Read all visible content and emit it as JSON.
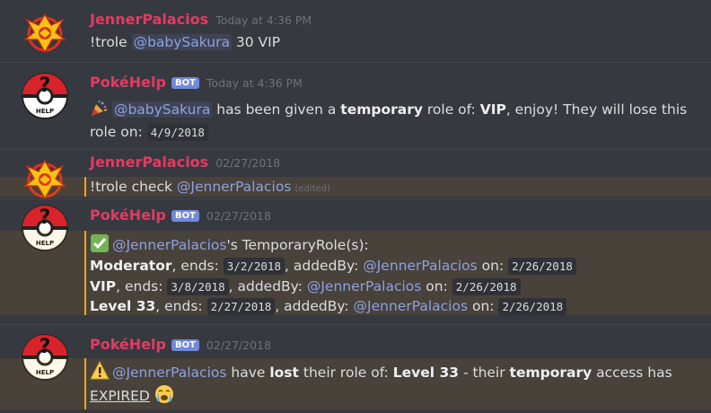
{
  "messages": [
    {
      "author": "JennerPalacios",
      "timestamp": "Today at 4:36 PM",
      "text_prefix": "!trole ",
      "mention": "@babySakura",
      "text_suffix": " 30 VIP"
    },
    {
      "author": "PokéHelp",
      "bot_tag": "BOT",
      "timestamp": "Today at 4:36 PM",
      "mention": "@babySakura",
      "t1": " has been given a ",
      "bold1": "temporary",
      "t2": " role of: ",
      "bold2": "VIP",
      "t3": ", enjoy! They will lose this",
      "t4": "role on: ",
      "date": "4/9/2018"
    },
    {
      "author": "JennerPalacios",
      "timestamp": "02/27/2018",
      "text_prefix": "!trole check ",
      "mention": "@JennerPalacios",
      "edited": "(edited)"
    },
    {
      "author": "PokéHelp",
      "bot_tag": "BOT",
      "timestamp": "02/27/2018",
      "mention": "@JennerPalacios",
      "header_suffix": "'s TemporaryRole(s):",
      "roles": [
        {
          "name": "Moderator",
          "ends_label": ", ends: ",
          "ends": "3/2/2018",
          "added_label": ", addedBy: ",
          "added_by": "@JennerPalacios",
          "on_label": " on: ",
          "on": "2/26/2018"
        },
        {
          "name": "VIP",
          "ends_label": ", ends: ",
          "ends": "3/8/2018",
          "added_label": ", addedBy: ",
          "added_by": "@JennerPalacios",
          "on_label": " on: ",
          "on": "2/26/2018"
        },
        {
          "name": "Level 33",
          "ends_label": ", ends: ",
          "ends": "2/27/2018",
          "added_label": ", addedBy: ",
          "added_by": "@JennerPalacios",
          "on_label": " on: ",
          "on": "2/26/2018"
        }
      ]
    },
    {
      "author": "PokéHelp",
      "bot_tag": "BOT",
      "timestamp": "02/27/2018",
      "mention": "@JennerPalacios",
      "t1": " have ",
      "bold1": "lost",
      "t2": " their role of: ",
      "bold2": "Level 33",
      "t3": " - their ",
      "bold3": "temporary",
      "t4": " access has",
      "expired": "EXPIRED"
    }
  ],
  "colors": {
    "background": "#36393f",
    "username": "#e53a63",
    "mention": "#8ea1e1",
    "bot_badge": "#7289da",
    "highlight_bar": "#faa61a"
  },
  "icons": [
    "valor-avatar",
    "pokehelp-avatar",
    "party-popper-icon",
    "check-mark-icon",
    "warning-icon",
    "crying-face-icon"
  ]
}
